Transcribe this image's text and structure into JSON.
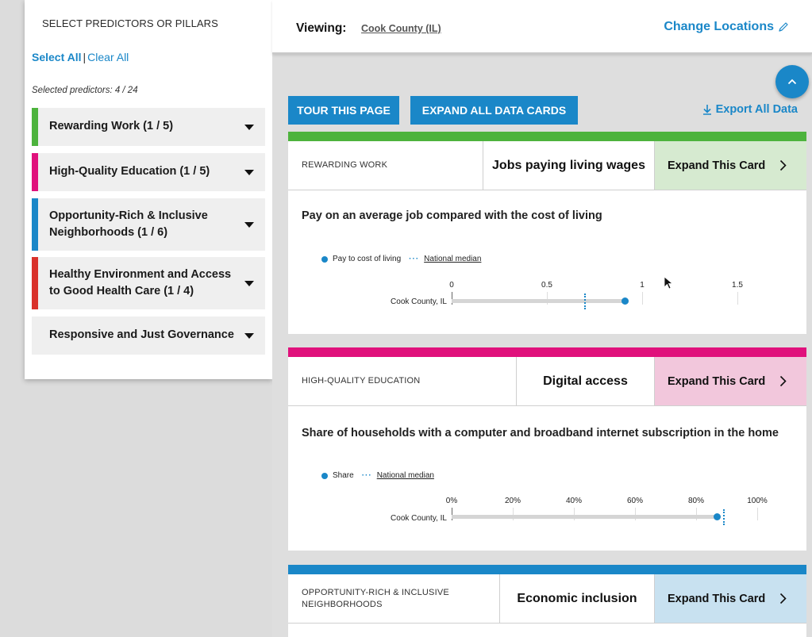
{
  "sidebar": {
    "title": "SELECT PREDICTORS OR PILLARS",
    "select_all": "Select All",
    "separator": "|",
    "clear_all": "Clear All",
    "selected_count": "Selected predictors: 4 / 24",
    "pillars": [
      {
        "label": "Rewarding Work (1 / 5)",
        "color": "#4db33d"
      },
      {
        "label": "High-Quality Education (1 / 5)",
        "color": "#e0117c"
      },
      {
        "label": "Opportunity-Rich & Inclusive Neighborhoods (1 / 6)",
        "color": "#1a87c8"
      },
      {
        "label": "Healthy Environment and Access to Good Health Care (1 / 4)",
        "color": "#d9312b"
      },
      {
        "label": "Responsive and Just Governance",
        "color": "#efefef"
      }
    ]
  },
  "header": {
    "viewing_label": "Viewing:",
    "viewing_value": "Cook County (IL)",
    "change_locations": "Change Locations"
  },
  "toolbar": {
    "tour": "TOUR THIS PAGE",
    "expand_all": "EXPAND ALL DATA CARDS",
    "export": "Export All Data"
  },
  "cards": [
    {
      "stripe_color": "#4db33d",
      "expand_bg": "#d6ead0",
      "pillar": "REWARDING WORK",
      "indicator": "Jobs paying living wages",
      "expand": "Expand This Card",
      "title": "Pay on an average job compared with the cost of living",
      "legend_value": "Pay to cost of living",
      "legend_median": "National median",
      "row_label": "Cook County, IL",
      "ticks": [
        "0",
        "0.5",
        "1",
        "1.5"
      ],
      "value": 0.91,
      "median": 0.7
    },
    {
      "stripe_color": "#e0117c",
      "expand_bg": "#f2c7dc",
      "pillar": "HIGH-QUALITY EDUCATION",
      "indicator": "Digital access",
      "expand": "Expand This Card",
      "title": "Share of households with a computer and broadband internet subscription in the home",
      "legend_value": "Share",
      "legend_median": "National median",
      "row_label": "Cook County, IL",
      "ticks": [
        "0%",
        "20%",
        "40%",
        "60%",
        "80%",
        "100%"
      ],
      "value": 0.87,
      "median": 0.89
    },
    {
      "stripe_color": "#1a87c8",
      "expand_bg": "#c8e1f0",
      "pillar_line1": "OPPORTUNITY-RICH & INCLUSIVE",
      "pillar_line2": "NEIGHBORHOODS",
      "indicator": "Economic inclusion",
      "expand": "Expand This Card"
    }
  ]
}
